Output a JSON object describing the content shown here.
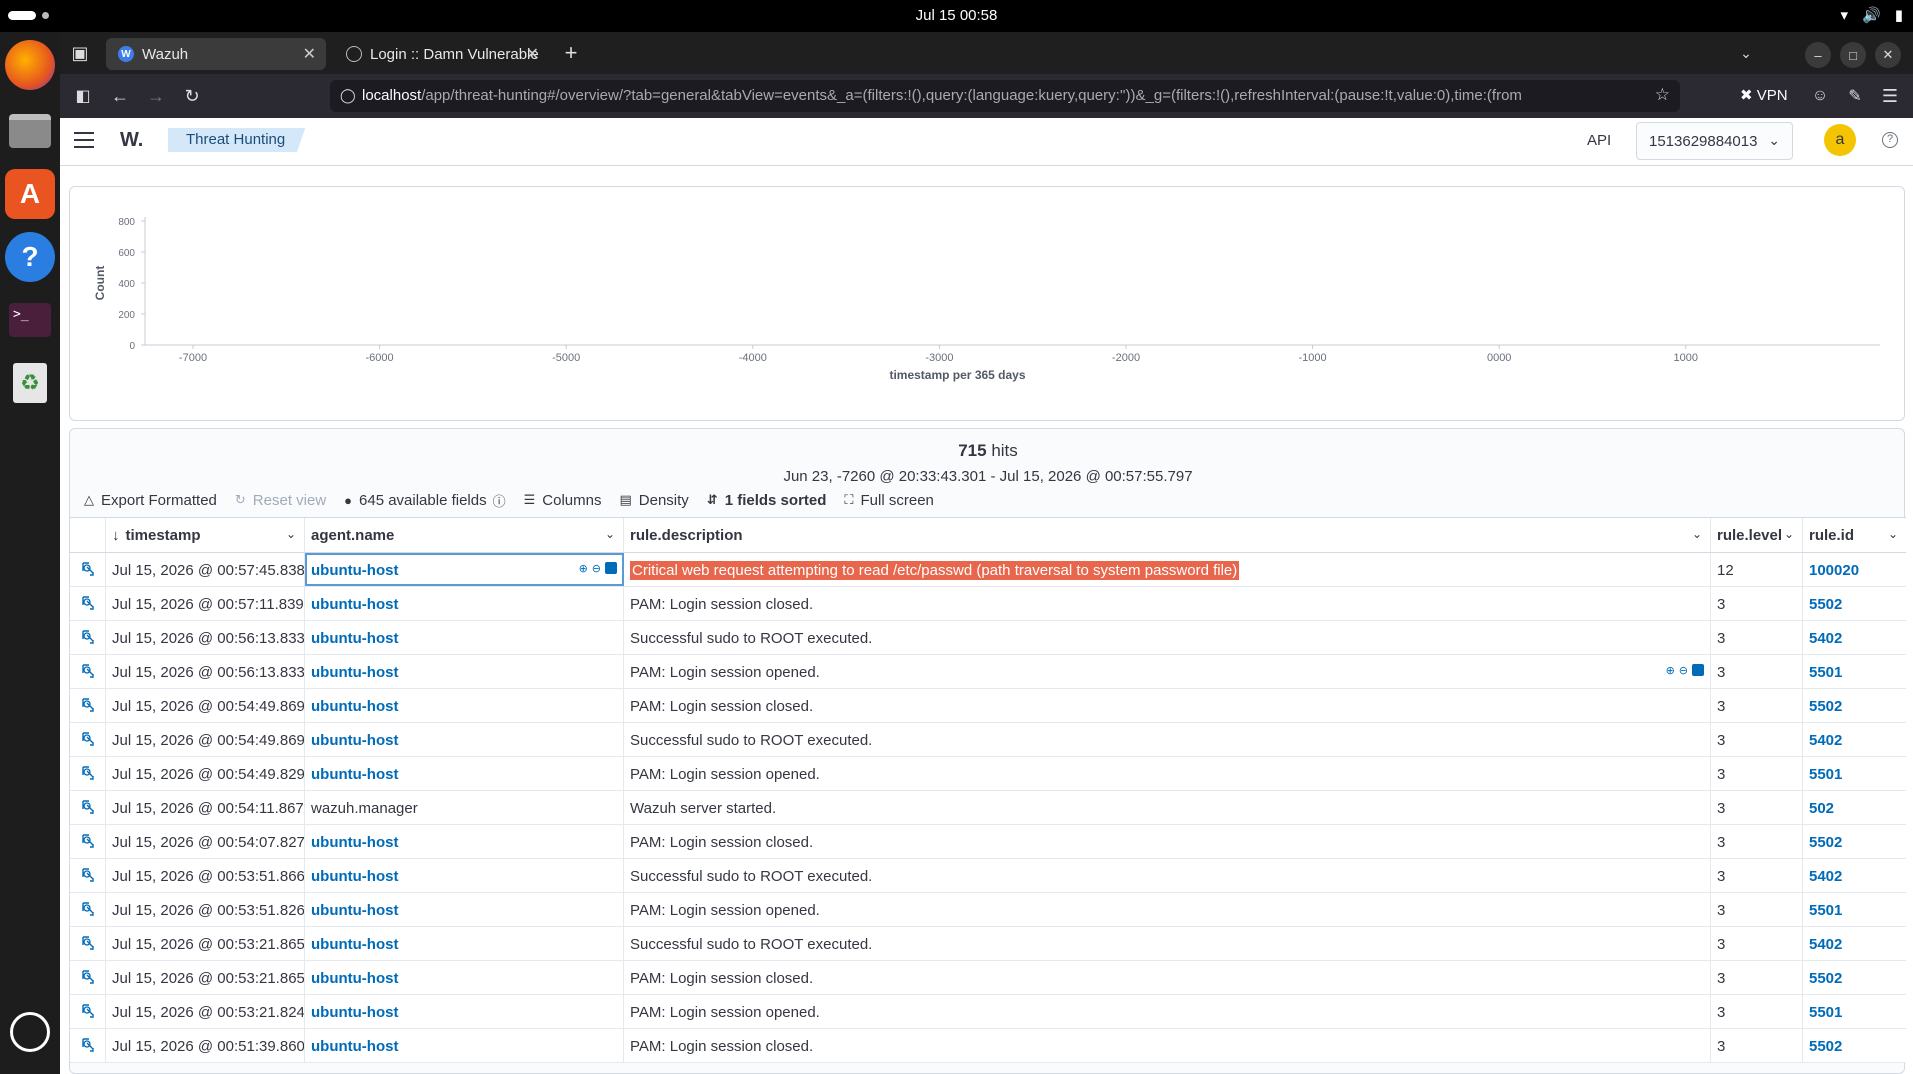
{
  "os": {
    "clock": "Jul 15  00:58",
    "dock_apps": [
      "firefox-icon",
      "files-icon",
      "app-center-icon",
      "help-icon",
      "terminal-icon",
      "trash-icon",
      "ubuntu-icon"
    ]
  },
  "browser": {
    "tabs": [
      {
        "title": "Wazuh",
        "active": true
      },
      {
        "title": "Login :: Damn Vulnerable",
        "active": false
      }
    ],
    "url_host": "localhost",
    "url_path": "/app/threat-hunting#/overview/?tab=general&tabView=events&_a=(filters:!(),query:(language:kuery,query:''))&_g=(filters:!(),refreshInterval:(pause:!t,value:0),time:(from",
    "vpn_label": "VPN"
  },
  "header": {
    "logo": "W.",
    "breadcrumb": "Threat Hunting",
    "api_label": "API",
    "api_value": "1513629884013",
    "avatar_letter": "a"
  },
  "chart_data": {
    "type": "bar",
    "title": "",
    "xlabel": "timestamp per 365 days",
    "ylabel": "Count",
    "ylim": [
      0,
      800
    ],
    "y_ticks": [
      "800",
      "600",
      "400",
      "200",
      "0"
    ],
    "x_ticks": [
      "-7000",
      "-6000",
      "-5000",
      "-4000",
      "-3000",
      "-2000",
      "-1000",
      "0000",
      "1000"
    ],
    "values": []
  },
  "results": {
    "hits_count": "715",
    "hits_label": "hits",
    "range": "Jun 23, -7260 @ 20:33:43.301 - Jul 15, 2026 @ 00:57:55.797",
    "toolbar": {
      "export": "Export Formatted",
      "reset": "Reset view",
      "fields": "645 available fields",
      "columns": "Columns",
      "density": "Density",
      "sorted": "1 fields sorted",
      "fullscreen": "Full screen"
    },
    "columns": [
      "timestamp",
      "agent.name",
      "rule.description",
      "rule.level",
      "rule.id"
    ],
    "rows": [
      {
        "timestamp": "Jul 15, 2026 @ 00:57:45.838",
        "agent": "ubuntu-host",
        "desc": "Critical web request attempting to read /etc/passwd (path traversal to system password file)",
        "level": "12",
        "id": "100020"
      },
      {
        "timestamp": "Jul 15, 2026 @ 00:57:11.839",
        "agent": "ubuntu-host",
        "desc": "PAM: Login session closed.",
        "level": "3",
        "id": "5502"
      },
      {
        "timestamp": "Jul 15, 2026 @ 00:56:13.833",
        "agent": "ubuntu-host",
        "desc": "Successful sudo to ROOT executed.",
        "level": "3",
        "id": "5402"
      },
      {
        "timestamp": "Jul 15, 2026 @ 00:56:13.833",
        "agent": "ubuntu-host",
        "desc": "PAM: Login session opened.",
        "level": "3",
        "id": "5501"
      },
      {
        "timestamp": "Jul 15, 2026 @ 00:54:49.869",
        "agent": "ubuntu-host",
        "desc": "PAM: Login session closed.",
        "level": "3",
        "id": "5502"
      },
      {
        "timestamp": "Jul 15, 2026 @ 00:54:49.869",
        "agent": "ubuntu-host",
        "desc": "Successful sudo to ROOT executed.",
        "level": "3",
        "id": "5402"
      },
      {
        "timestamp": "Jul 15, 2026 @ 00:54:49.829",
        "agent": "ubuntu-host",
        "desc": "PAM: Login session opened.",
        "level": "3",
        "id": "5501"
      },
      {
        "timestamp": "Jul 15, 2026 @ 00:54:11.867",
        "agent": "wazuh.manager",
        "desc": "Wazuh server started.",
        "level": "3",
        "id": "502"
      },
      {
        "timestamp": "Jul 15, 2026 @ 00:54:07.827",
        "agent": "ubuntu-host",
        "desc": "PAM: Login session closed.",
        "level": "3",
        "id": "5502"
      },
      {
        "timestamp": "Jul 15, 2026 @ 00:53:51.866",
        "agent": "ubuntu-host",
        "desc": "Successful sudo to ROOT executed.",
        "level": "3",
        "id": "5402"
      },
      {
        "timestamp": "Jul 15, 2026 @ 00:53:51.826",
        "agent": "ubuntu-host",
        "desc": "PAM: Login session opened.",
        "level": "3",
        "id": "5501"
      },
      {
        "timestamp": "Jul 15, 2026 @ 00:53:21.865",
        "agent": "ubuntu-host",
        "desc": "Successful sudo to ROOT executed.",
        "level": "3",
        "id": "5402"
      },
      {
        "timestamp": "Jul 15, 2026 @ 00:53:21.865",
        "agent": "ubuntu-host",
        "desc": "PAM: Login session closed.",
        "level": "3",
        "id": "5502"
      },
      {
        "timestamp": "Jul 15, 2026 @ 00:53:21.824",
        "agent": "ubuntu-host",
        "desc": "PAM: Login session opened.",
        "level": "3",
        "id": "5501"
      },
      {
        "timestamp": "Jul 15, 2026 @ 00:51:39.860",
        "agent": "ubuntu-host",
        "desc": "PAM: Login session closed.",
        "level": "3",
        "id": "5502"
      }
    ]
  },
  "colors": {
    "link": "#006bb8",
    "highlight": "#e7664c",
    "breadcrumb_bg": "#d5e8fa",
    "avatar": "#f5c400"
  }
}
